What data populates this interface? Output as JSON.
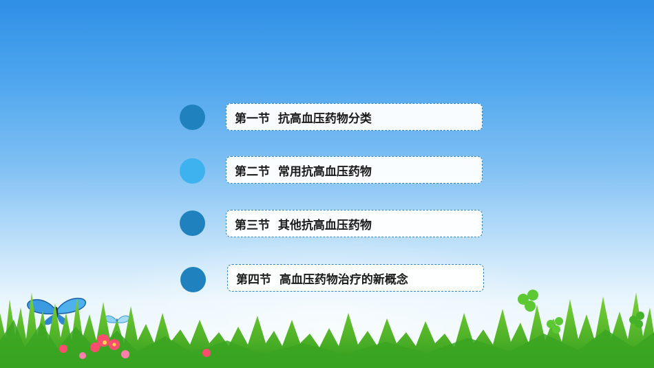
{
  "items": [
    {
      "label": "第一节  抗高血压药物分类",
      "dot_color": "#1f82be"
    },
    {
      "label": "第二节  常用抗高血压药物",
      "dot_color": "#3eb2ee"
    },
    {
      "label": "第三节  其他抗高血压药物",
      "dot_color": "#1f82be"
    },
    {
      "label": "第四节  高血压药物治疗的新概念",
      "dot_color": "#1f82be"
    }
  ],
  "decorations": {
    "background": "blue-sky-gradient",
    "bottom": "grass-with-flowers-and-clovers",
    "butterfly_large": "blue-butterfly-icon",
    "butterfly_small": "small-blue-butterfly-icon"
  }
}
